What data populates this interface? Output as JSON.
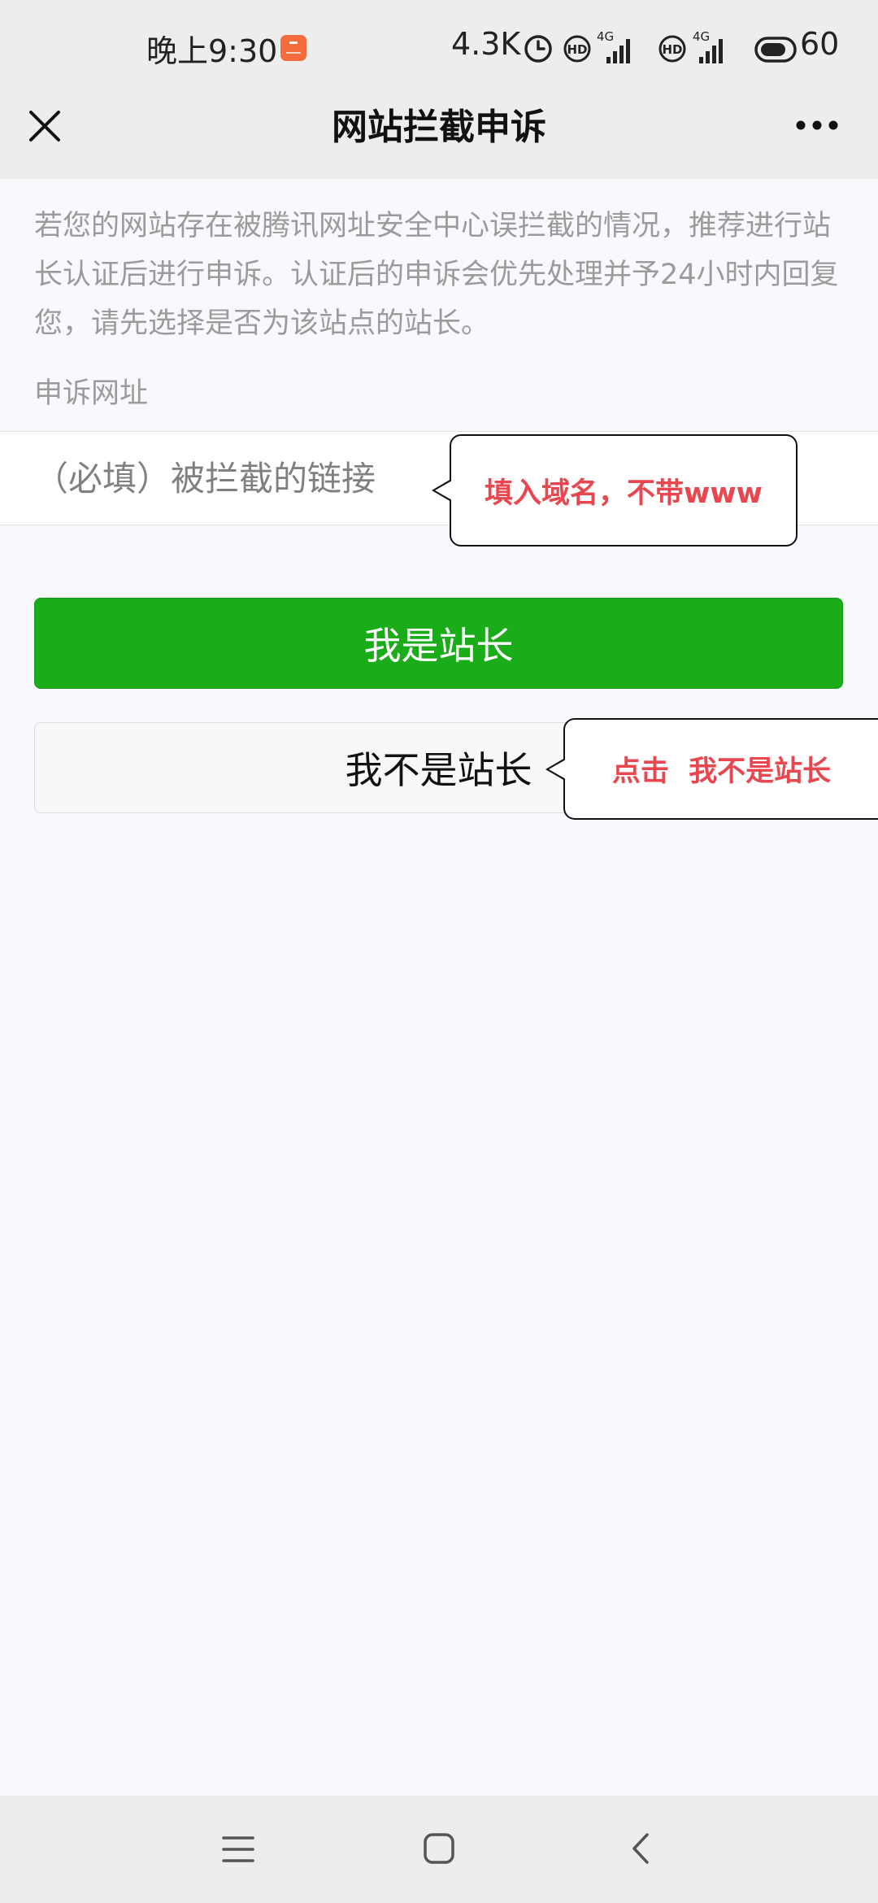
{
  "status_bar": {
    "time": "晚上9:30",
    "network_speed": "4.3K",
    "battery": "60",
    "signal_labels": [
      "4G",
      "4G"
    ],
    "icons": [
      "app-notification-icon",
      "alarm-icon",
      "hd-icon",
      "signal-icon",
      "hd-icon",
      "signal-icon",
      "battery-icon"
    ]
  },
  "nav": {
    "title": "网站拦截申诉",
    "close_icon": "close-icon",
    "more_icon": "more-icon"
  },
  "intro": {
    "text": "若您的网站存在被腾讯网址安全中心误拦截的情况，推荐进行站长认证后进行申诉。认证后的申诉会优先处理并予24小时内回复您，请先选择是否为该站点的站长。"
  },
  "form": {
    "section_label": "申诉网址",
    "url_input": {
      "value": "",
      "placeholder": "（必填）被拦截的链接"
    },
    "primary_button": "我是站长",
    "secondary_button": "我不是站长"
  },
  "annotations": {
    "domain_hint": "填入域名，不带www",
    "click_hint": "点击  我不是站长"
  },
  "system_nav": {
    "icons": [
      "menu-icon",
      "home-icon",
      "back-icon"
    ]
  },
  "colors": {
    "primary_green": "#1aad19",
    "annotation_red": "#e9474f",
    "bar_gray": "#ededed",
    "page_bg": "#f9f8fc",
    "hint_text": "#9b9b9b"
  }
}
